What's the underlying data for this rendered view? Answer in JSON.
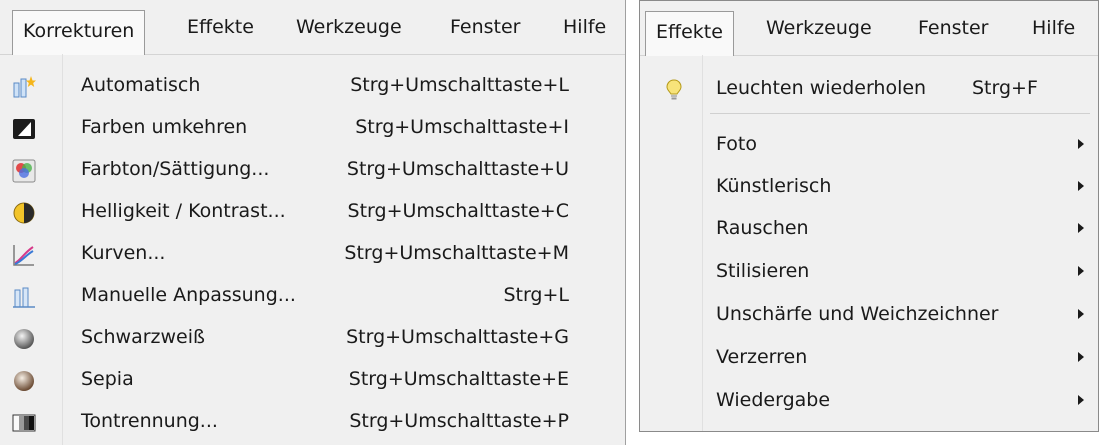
{
  "left_menu": {
    "menubar": [
      {
        "label": "Korrekturen",
        "active": true
      },
      {
        "label": "Effekte",
        "active": false
      },
      {
        "label": "Werkzeuge",
        "active": false
      },
      {
        "label": "Fenster",
        "active": false
      },
      {
        "label": "Hilfe",
        "active": false
      }
    ],
    "items": [
      {
        "label": "Automatisch",
        "shortcut": "Strg+Umschalttaste+L",
        "icon": "auto-level-icon"
      },
      {
        "label": "Farben umkehren",
        "shortcut": "Strg+Umschalttaste+I",
        "icon": "invert-colors-icon"
      },
      {
        "label": "Farbton/Sättigung...",
        "shortcut": "Strg+Umschalttaste+U",
        "icon": "hue-saturation-icon"
      },
      {
        "label": "Helligkeit / Kontrast...",
        "shortcut": "Strg+Umschalttaste+C",
        "icon": "brightness-contrast-icon"
      },
      {
        "label": "Kurven...",
        "shortcut": "Strg+Umschalttaste+M",
        "icon": "curves-icon"
      },
      {
        "label": "Manuelle Anpassung...",
        "shortcut": "Strg+L",
        "icon": "levels-icon"
      },
      {
        "label": "Schwarzweiß",
        "shortcut": "Strg+Umschalttaste+G",
        "icon": "black-white-icon"
      },
      {
        "label": "Sepia",
        "shortcut": "Strg+Umschalttaste+E",
        "icon": "sepia-icon"
      },
      {
        "label": "Tontrennung...",
        "shortcut": "Strg+Umschalttaste+P",
        "icon": "posterize-icon"
      }
    ]
  },
  "right_menu": {
    "menubar": [
      {
        "label": "Effekte",
        "active": true
      },
      {
        "label": "Werkzeuge",
        "active": false
      },
      {
        "label": "Fenster",
        "active": false
      },
      {
        "label": "Hilfe",
        "active": false
      }
    ],
    "repeat_item": {
      "label": "Leuchten wiederholen",
      "shortcut": "Strg+F",
      "icon": "lightbulb-icon"
    },
    "items": [
      {
        "label": "Foto"
      },
      {
        "label": "Künstlerisch"
      },
      {
        "label": "Rauschen"
      },
      {
        "label": "Stilisieren"
      },
      {
        "label": "Unschärfe und Weichzeichner"
      },
      {
        "label": "Verzerren"
      },
      {
        "label": "Wiedergabe"
      }
    ]
  },
  "colors": {
    "menu_bg": "#f0f0f0",
    "text": "#1a1a1a",
    "active_bg": "#f9f9f9",
    "border": "#9a9a9a",
    "separator": "#d0d0d0"
  }
}
